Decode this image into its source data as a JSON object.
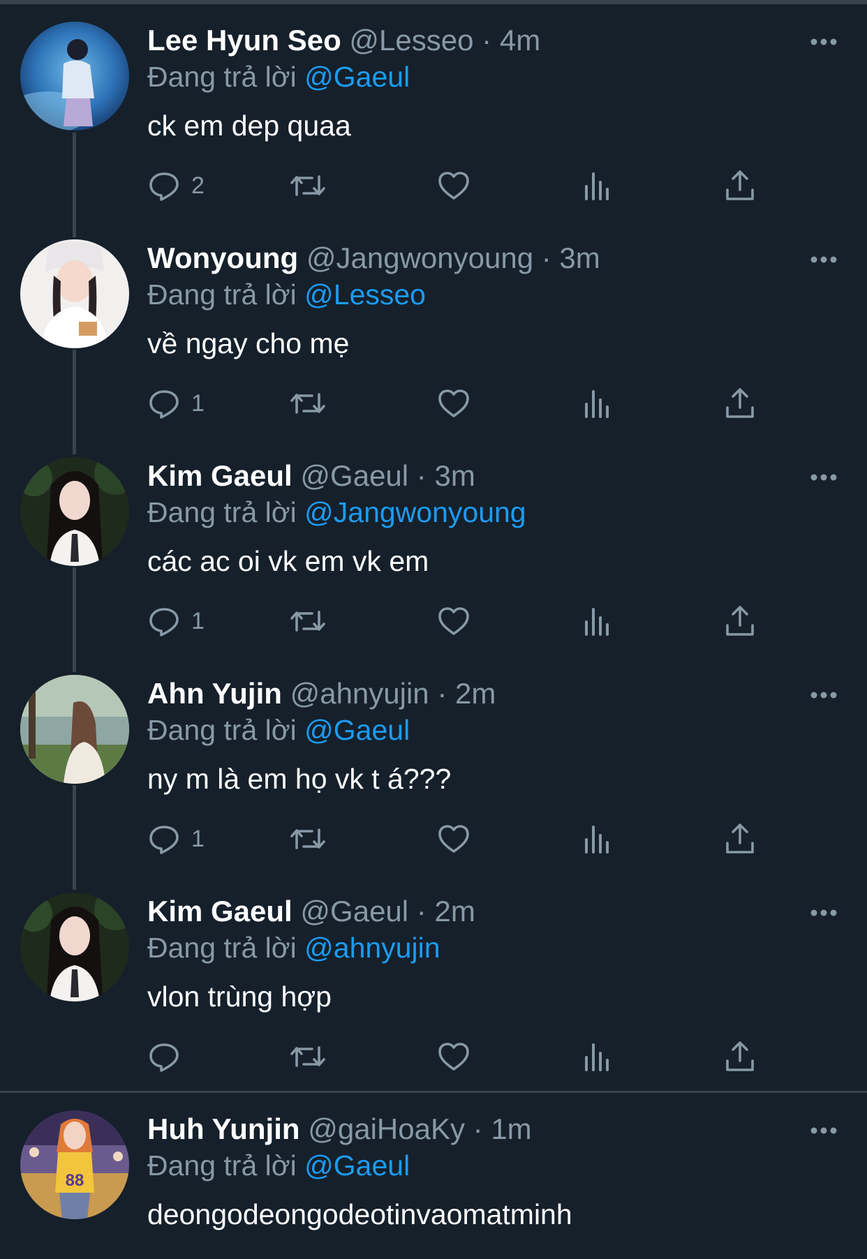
{
  "tweets": [
    {
      "name": "Lee Hyun Seo",
      "handle": "@Lesseo",
      "dot": "·",
      "time": "4m",
      "reply_prefix": "Đang trả lời",
      "reply_to": "@Gaeul",
      "text": "ck em dep quaa",
      "reply_count": "2",
      "avatar": "avatar-lee-hyun-seo"
    },
    {
      "name": "Wonyoung",
      "handle": "@Jangwonyoung",
      "dot": "·",
      "time": "3m",
      "reply_prefix": "Đang trả lời",
      "reply_to": "@Lesseo",
      "text": "về ngay cho mẹ",
      "reply_count": "1",
      "avatar": "avatar-wonyoung"
    },
    {
      "name": "Kim Gaeul",
      "handle": "@Gaeul",
      "dot": "·",
      "time": "3m",
      "reply_prefix": "Đang trả lời",
      "reply_to": "@Jangwonyoung",
      "text": "các ac oi vk em vk em",
      "reply_count": "1",
      "avatar": "avatar-kim-gaeul"
    },
    {
      "name": "Ahn Yujin",
      "handle": "@ahnyujin",
      "dot": "·",
      "time": "2m",
      "reply_prefix": "Đang trả lời",
      "reply_to": "@Gaeul",
      "text": "ny m là em họ vk t á???",
      "reply_count": "1",
      "avatar": "avatar-ahn-yujin"
    },
    {
      "name": "Kim Gaeul",
      "handle": "@Gaeul",
      "dot": "·",
      "time": "2m",
      "reply_prefix": "Đang trả lời",
      "reply_to": "@ahnyujin",
      "text": "vlon trùng hợp",
      "reply_count": "",
      "avatar": "avatar-kim-gaeul"
    },
    {
      "name": "Huh Yunjin",
      "handle": "@gaiHoaKy",
      "dot": "·",
      "time": "1m",
      "reply_prefix": "Đang trả lời",
      "reply_to": "@Gaeul",
      "text": "deongodeongodeotinvaomatminh",
      "avatar": "avatar-huh-yunjin"
    }
  ],
  "icons": {
    "reply": "reply-icon",
    "retweet": "retweet-icon",
    "like": "heart-icon",
    "views": "views-icon",
    "share": "share-icon",
    "more": "more-icon"
  },
  "colors": {
    "background": "#15202b",
    "text": "#ffffff",
    "secondary": "#8899a6",
    "accent": "#1d9bf0",
    "divider": "#38444d"
  }
}
